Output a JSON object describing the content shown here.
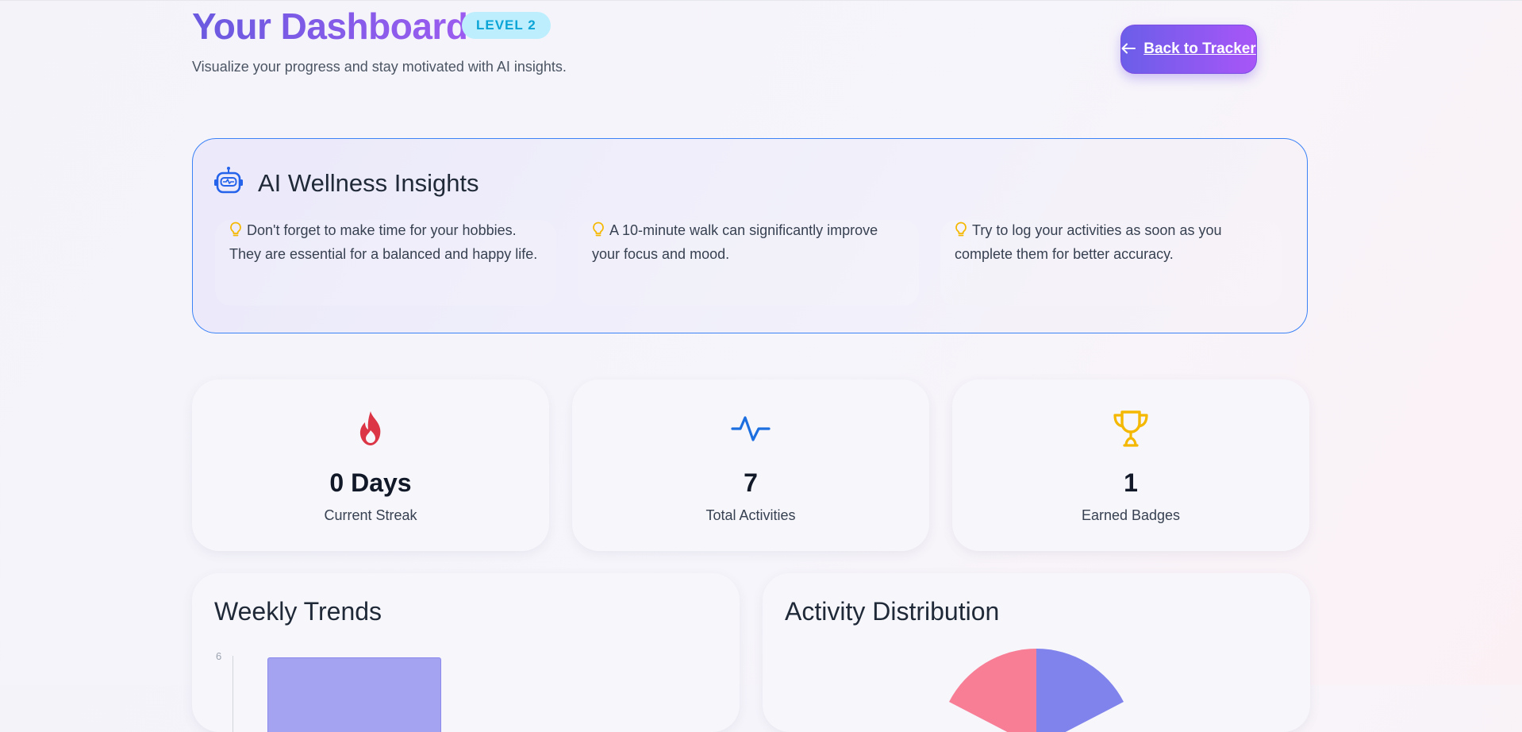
{
  "header": {
    "title": "Your Dashboard",
    "level_badge": "LEVEL 2",
    "subtitle": "Visualize your progress and stay motivated with AI insights.",
    "back_button_label": "Back to Tracker"
  },
  "insights": {
    "title": "AI Wellness Insights",
    "icon": "robot-icon",
    "tips": [
      {
        "icon": "lightbulb-icon",
        "text": "Don't forget to make time for your hobbies. They are essential for a balanced and happy life."
      },
      {
        "icon": "lightbulb-icon",
        "text": "A 10-minute walk can significantly improve your focus and mood."
      },
      {
        "icon": "lightbulb-icon",
        "text": "Try to log your activities as soon as you complete them for better accuracy."
      }
    ]
  },
  "stats": [
    {
      "icon": "flame-icon",
      "value": "0 Days",
      "label": "Current Streak",
      "color": "#dc3545"
    },
    {
      "icon": "activity-pulse-icon",
      "value": "7",
      "label": "Total Activities",
      "color": "#1d6fe0"
    },
    {
      "icon": "trophy-icon",
      "value": "1",
      "label": "Earned Badges",
      "color": "#f5b800"
    }
  ],
  "weekly_trends": {
    "title": "Weekly Trends",
    "y_tick_visible": "6",
    "bar_color": "#a3a3f2"
  },
  "activity_distribution": {
    "title": "Activity Distribution",
    "slice_colors": [
      "#f87e96",
      "#8083ec"
    ]
  },
  "colors": {
    "accent_start": "#6a5ae0",
    "accent_end": "#a855f7",
    "insights_border": "#3b82f6",
    "badge_bg": "#bdeefd",
    "badge_text": "#0aa4d6"
  }
}
